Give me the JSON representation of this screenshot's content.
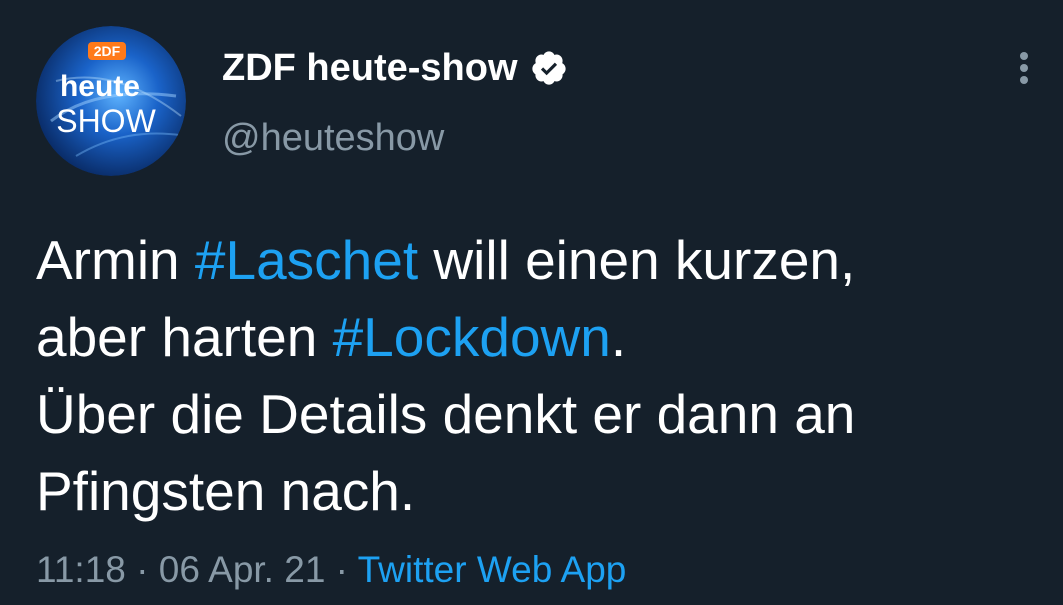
{
  "colors": {
    "background": "#15202b",
    "primary_text": "#ffffff",
    "secondary_text": "#8899a6",
    "link": "#1da1f2"
  },
  "author": {
    "avatar": {
      "icon": "heute-show-logo-icon",
      "brand_badge": "2DF",
      "line1": "heute",
      "line2": "SHOW"
    },
    "display_name": "ZDF heute-show",
    "verified_icon": "verified-badge-icon",
    "handle": "@heuteshow"
  },
  "more_menu_icon": "vertical-ellipsis-icon",
  "tweet": {
    "line1": {
      "t1": "Armin ",
      "h1": "#Laschet",
      "t2": " will einen kurzen,"
    },
    "line2": {
      "t1": "aber harten ",
      "h1": "#Lockdown",
      "t2": "."
    },
    "line3": "Über die Details denkt er dann an",
    "line4": "Pfingsten nach."
  },
  "meta": {
    "time": "11:18",
    "separator": " · ",
    "date": "06 Apr. 21",
    "source": "Twitter Web App"
  }
}
